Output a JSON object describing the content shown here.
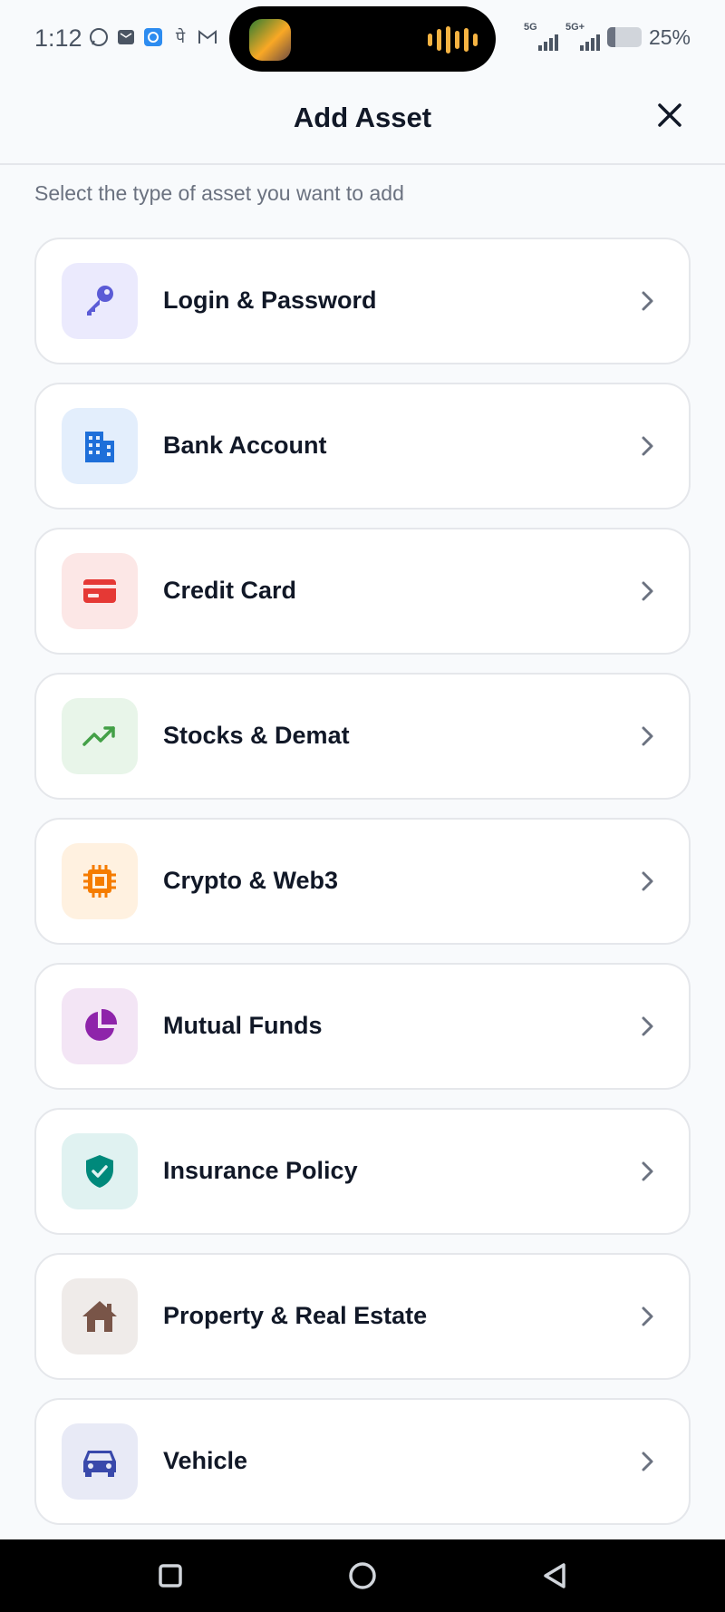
{
  "status_bar": {
    "time": "1:12",
    "left_icons": [
      "whatsapp-icon",
      "mail-app-icon",
      "chat-app-icon",
      "phonepe-icon",
      "gmail-icon"
    ],
    "phonepe_glyph": "पे",
    "network_1": "5G",
    "network_2": "5G+",
    "battery_percent": 25,
    "battery_text": "25%"
  },
  "header": {
    "title": "Add Asset",
    "close_icon": "close-icon"
  },
  "subtitle": "Select the type of asset you want to add",
  "asset_types": [
    {
      "label": "Login & Password",
      "icon": "key-icon",
      "icon_color": "#5b5bd6",
      "bg_color": "#ebeafd"
    },
    {
      "label": "Bank Account",
      "icon": "bank-building-icon",
      "icon_color": "#1e6fd9",
      "bg_color": "#e3eefc"
    },
    {
      "label": "Credit Card",
      "icon": "credit-card-icon",
      "icon_color": "#e53935",
      "bg_color": "#fce7e6"
    },
    {
      "label": "Stocks & Demat",
      "icon": "trending-up-icon",
      "icon_color": "#43a047",
      "bg_color": "#e8f5e9"
    },
    {
      "label": "Crypto & Web3",
      "icon": "chip-icon",
      "icon_color": "#f57c00",
      "bg_color": "#fff1e0"
    },
    {
      "label": "Mutual Funds",
      "icon": "pie-chart-icon",
      "icon_color": "#8e24aa",
      "bg_color": "#f3e5f5"
    },
    {
      "label": "Insurance Policy",
      "icon": "shield-check-icon",
      "icon_color": "#00897b",
      "bg_color": "#e0f2f1"
    },
    {
      "label": "Property & Real Estate",
      "icon": "house-icon",
      "icon_color": "#795548",
      "bg_color": "#efebe9"
    },
    {
      "label": "Vehicle",
      "icon": "car-icon",
      "icon_color": "#3949ab",
      "bg_color": "#e8eaf6"
    }
  ],
  "colors": {
    "background": "#f8fafc",
    "card_border": "#e5e7eb",
    "chevron": "#6b7280"
  },
  "nav_bar": {
    "buttons": [
      "recents-square-icon",
      "home-circle-icon",
      "back-triangle-icon"
    ]
  }
}
